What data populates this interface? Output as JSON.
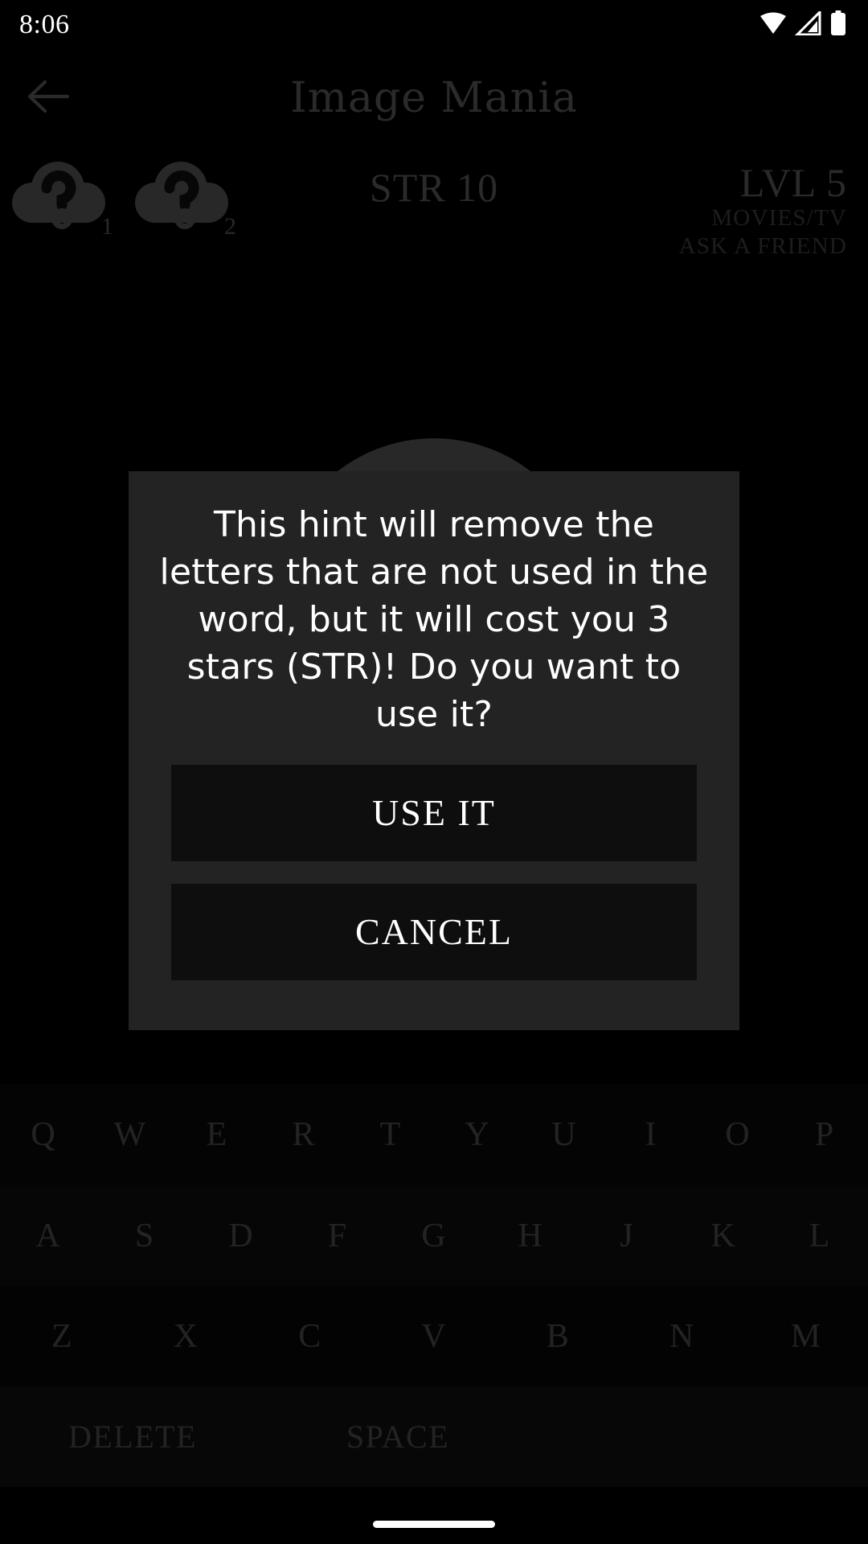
{
  "status_bar": {
    "time": "8:06",
    "icons": [
      "wifi-icon",
      "cellular-signal-icon",
      "battery-icon"
    ]
  },
  "app_bar": {
    "back_icon": "arrow-left-icon",
    "title": "Image Mania"
  },
  "stats": {
    "hints": [
      {
        "icon": "hint-question-cloud-icon",
        "count": "1"
      },
      {
        "icon": "hint-question-cloud-icon",
        "count": "2"
      }
    ],
    "stars": "STR 10",
    "level": "LVL 5",
    "category": "MOVIES/TV",
    "lifeline": "ASK A FRIEND"
  },
  "dialog": {
    "message": "This hint will remove the letters that are not used in the word, but it will cost you 3 stars (STR)! Do you want to use it?",
    "confirm_label": "USE IT",
    "cancel_label": "CANCEL"
  },
  "keyboard": {
    "row1": [
      "Q",
      "W",
      "E",
      "R",
      "T",
      "Y",
      "U",
      "I",
      "O",
      "P"
    ],
    "row2": [
      "A",
      "S",
      "D",
      "F",
      "G",
      "H",
      "J",
      "K",
      "L"
    ],
    "row3": [
      "Z",
      "X",
      "C",
      "V",
      "B",
      "N",
      "M"
    ],
    "delete_label": "DELETE",
    "space_label": "SPACE"
  },
  "colors": {
    "background": "#000000",
    "dialog_surface": "#232323",
    "dialog_button": "#0e0e0e",
    "muted_text": "#6e6e6e",
    "dim_text": "#4e4e4e",
    "key_text": "#5d5d5d",
    "accent_white": "#ffffff",
    "image_placeholder": "#6b6b6b"
  }
}
